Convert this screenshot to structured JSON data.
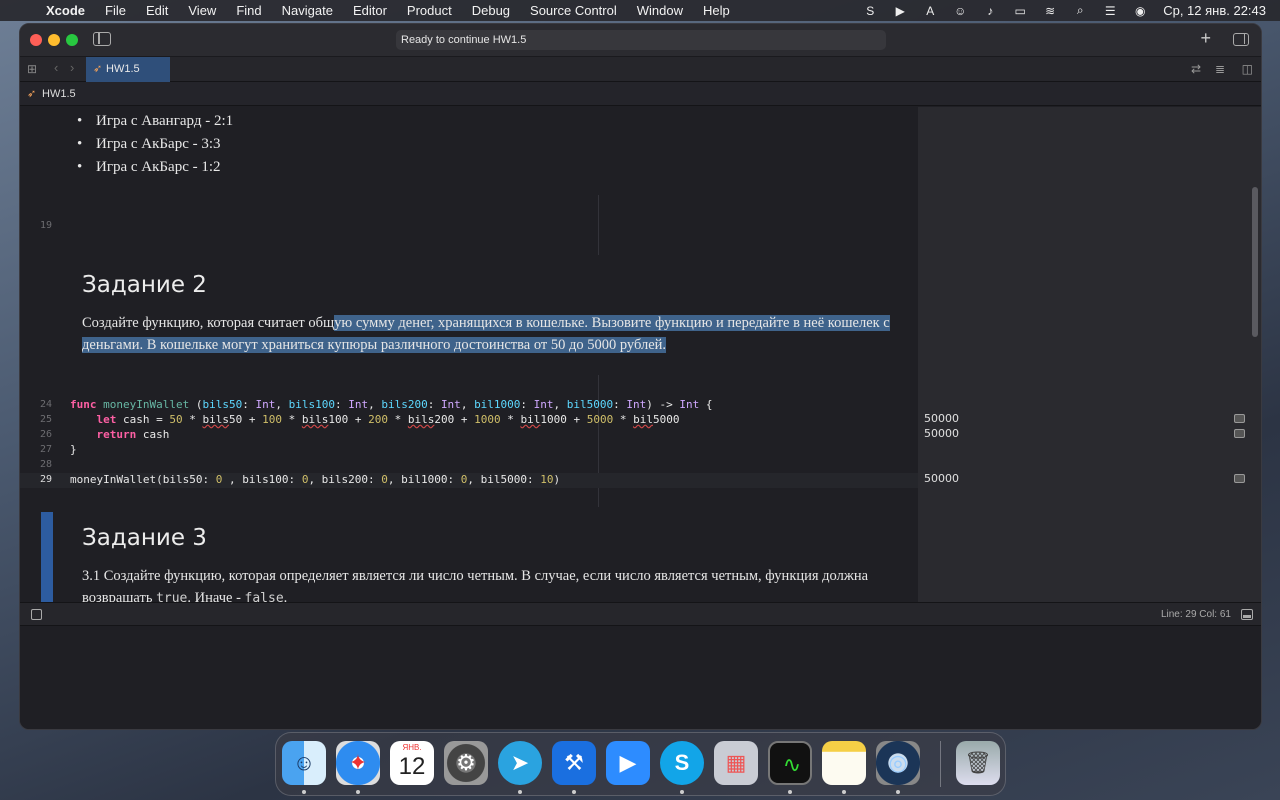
{
  "menubar": {
    "app": "Xcode",
    "items": [
      "File",
      "Edit",
      "View",
      "Find",
      "Navigate",
      "Editor",
      "Product",
      "Debug",
      "Source Control",
      "Window",
      "Help"
    ],
    "clock": "Ср, 12 янв. 22:43",
    "status_icons": [
      "skype-icon",
      "play-icon",
      "input-source-icon",
      "user-icon",
      "volume-icon",
      "battery-icon",
      "wifi-icon",
      "spotlight-icon",
      "control-center-icon",
      "siri-icon"
    ]
  },
  "window": {
    "activity": "Ready to continue HW1.5",
    "tab": "HW1.5",
    "jumpbar": "HW1.5"
  },
  "editor": {
    "bullets": [
      "Игра с Авангард - 2:1",
      "Игра с АкБарс - 3:3",
      "Игра с АкБарс - 1:2"
    ],
    "line19": "19",
    "heading2": "Задание 2",
    "para2_plain": "Создайте функцию, которая считает общ",
    "para2_selected": "ую сумму денег, хранящихся в кошельке. Вызовите функцию и передайте в неё кошелек с деньгами. В кошельке могут храниться купюры различного достоинства от 50 до 5000 рублей.",
    "code_lines": [
      {
        "n": "24"
      },
      {
        "n": "25"
      },
      {
        "n": "26"
      },
      {
        "n": "27"
      },
      {
        "n": "28"
      },
      {
        "n": "29"
      }
    ],
    "heading3": "Задание 3",
    "para3a": "3.1 Создайте функцию, которая определяет является ли число четным. В случае, если число является четным, функция должна",
    "para3b_start": "возвращать ",
    "para3b_true": "true",
    "para3b_mid": ". Иначе - ",
    "para3b_false": "false",
    "para3b_end": "."
  },
  "results": [
    "50000",
    "50000",
    "50000"
  ],
  "statusbar": {
    "position": "Line: 29  Col: 61"
  },
  "dock": {
    "calendar_month": "ЯНВ.",
    "calendar_day": "12",
    "apps": [
      "finder",
      "safari",
      "calendar",
      "system-preferences",
      "telegram",
      "xcode",
      "zoom",
      "skype",
      "launchpad",
      "activity-monitor",
      "notes",
      "quicktime",
      "trash"
    ]
  }
}
